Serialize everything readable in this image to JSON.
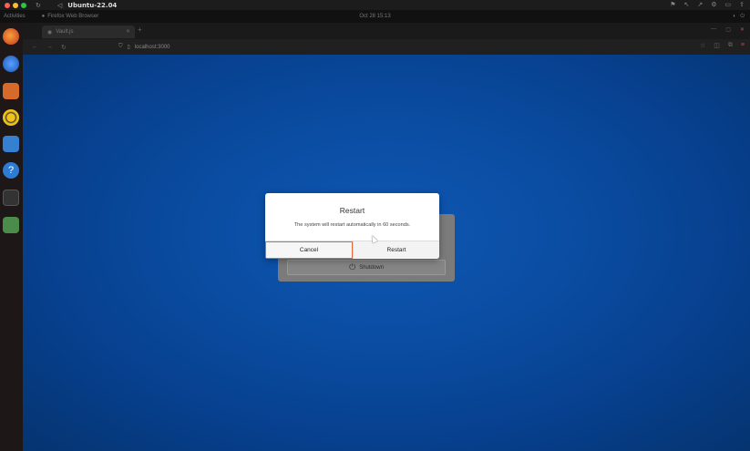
{
  "mac_bar": {
    "title": "Ubuntu-22.04",
    "traffic_colors": [
      "#ff5f57",
      "#febc2e",
      "#28c840"
    ]
  },
  "ubuntu_bar": {
    "activities": "Activities",
    "app_name": "Firefox Web Browser",
    "clock": "Oct 28 15:13"
  },
  "browser": {
    "tab_title": "Vault.js",
    "url": "localhost:3000"
  },
  "background_dialog": {
    "shutdown_label": "Shutdown"
  },
  "modal": {
    "title": "Restart",
    "message": "The system will restart automatically in 60 seconds.",
    "cancel_label": "Cancel",
    "restart_label": "Restart",
    "cancel_border_color": "#e06a3b"
  }
}
